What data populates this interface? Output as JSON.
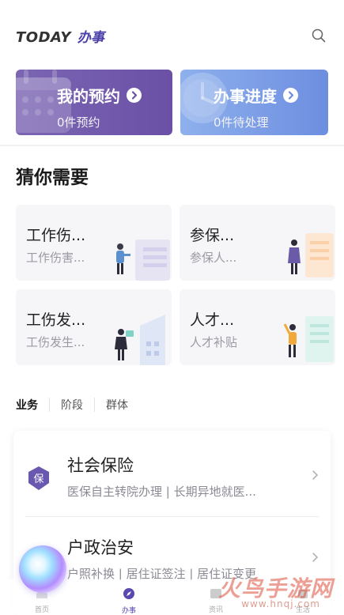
{
  "header": {
    "brand_en": "TODAY",
    "brand_cn": "办事"
  },
  "top_cards": [
    {
      "title": "我的预约",
      "subtitle": "0件预约",
      "color": "#6b50a6"
    },
    {
      "title": "办事进度",
      "subtitle": "0件待处理",
      "color": "#6d8ee0"
    }
  ],
  "section_title": "猜你需要",
  "recommendations": [
    {
      "title": "工作伤...",
      "subtitle": "工作伤害..."
    },
    {
      "title": "参保...",
      "subtitle": "参保人..."
    },
    {
      "title": "工伤发...",
      "subtitle": "工伤发生..."
    },
    {
      "title": "人才...",
      "subtitle": "人才补贴"
    }
  ],
  "tabs": [
    {
      "label": "业务",
      "active": true
    },
    {
      "label": "阶段",
      "active": false
    },
    {
      "label": "群体",
      "active": false
    }
  ],
  "services": [
    {
      "icon_text": "保",
      "name": "社会保险",
      "desc": "医保自主转院办理 | 长期异地就医..."
    },
    {
      "icon_text": "",
      "name": "户政治安",
      "desc": "户照补换 | 居住证签注 | 居住证变更"
    }
  ],
  "bottom_nav": [
    {
      "label": "首页",
      "icon": "home-icon"
    },
    {
      "label": "办事",
      "icon": "compass-icon",
      "active": true
    },
    {
      "label": "资讯",
      "icon": "news-icon"
    },
    {
      "label": "生活",
      "icon": "life-icon"
    }
  ],
  "watermark": {
    "title": "火鸟手游网",
    "url": "www.hnqj.com"
  },
  "colors": {
    "accent": "#5a48b0",
    "purple_card": "#6b50a6",
    "blue_card": "#6d8ee0"
  }
}
